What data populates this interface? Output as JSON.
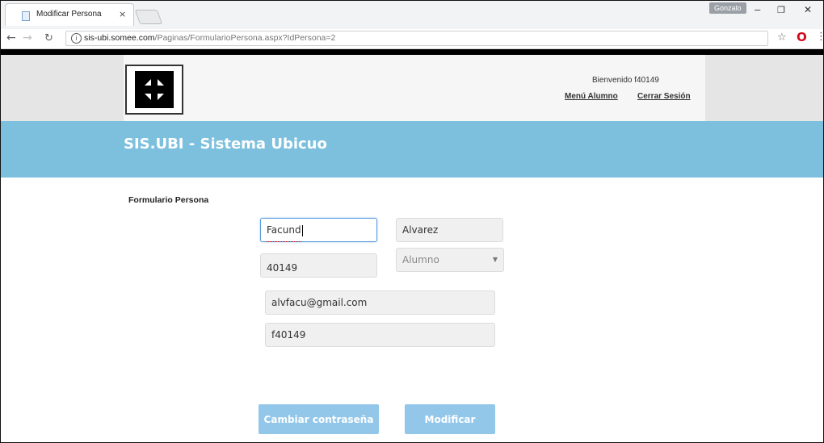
{
  "browser": {
    "tab_title": "Modificar Persona",
    "tab_close": "×",
    "profile_name": "Gonzalo",
    "win_minimize": "–",
    "win_restore": "❐",
    "win_close": "✕",
    "url_domain": "sis-ubi.somee.com",
    "url_path": "/Paginas/FormularioPersona.aspx?IdPersona=2"
  },
  "header": {
    "welcome": "Bienvenido f40149",
    "menu_link": "Menú Alumno",
    "logout_link": "Cerrar Sesión"
  },
  "banner": {
    "title": "SIS.UBI - Sistema Ubicuo"
  },
  "form": {
    "title": "Formulario Persona",
    "first_name": "Facund",
    "last_name": "Alvarez",
    "legajo": "40149",
    "role": "Alumno",
    "email": "alvfacu@gmail.com",
    "username": "f40149",
    "change_password_button": "Cambiar contraseña",
    "modify_button": "Modificar"
  },
  "colors": {
    "banner": "#7cc0de",
    "button": "#92c7ea",
    "focus": "#5b9ddd"
  }
}
